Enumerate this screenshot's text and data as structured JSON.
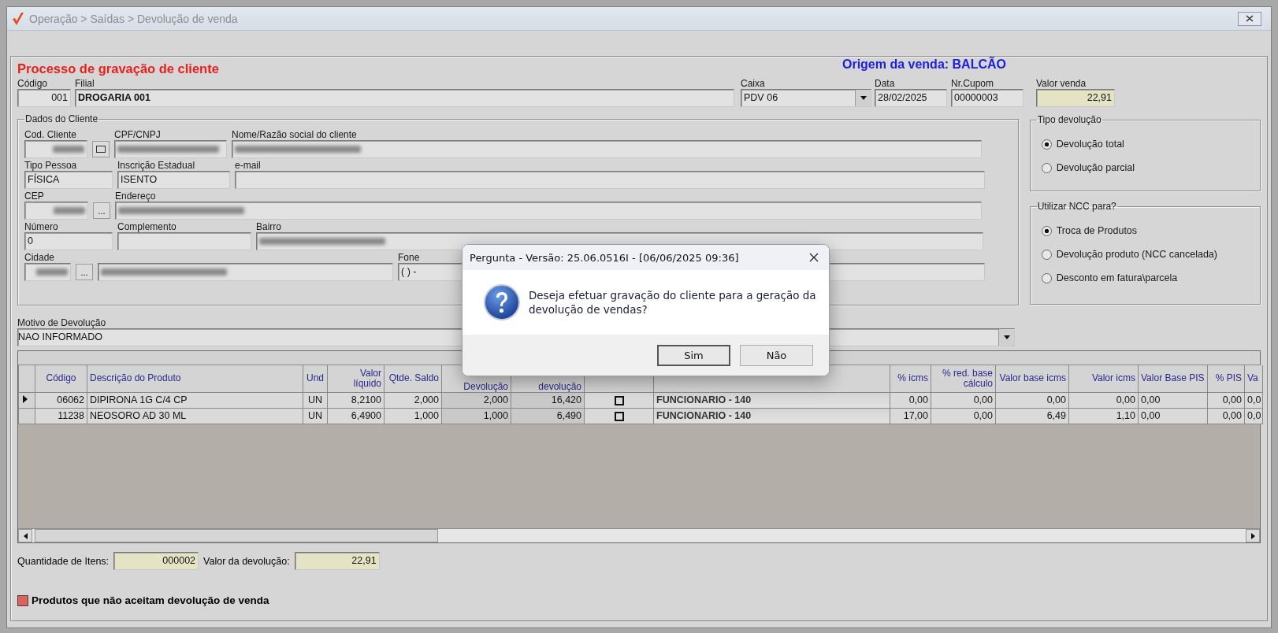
{
  "window": {
    "title": "Operação > Saídas > Devolução de venda"
  },
  "form": {
    "heading": "Processo de gravação de cliente",
    "origin": "Origem da venda: BALCÃO",
    "fields": [
      {
        "label": "Código",
        "value": "001",
        "kind": "text"
      },
      {
        "label": "Filial",
        "value": "DROGARIA 001",
        "kind": "text"
      },
      {
        "label": "Caixa",
        "value": "PDV 06",
        "kind": "combo"
      },
      {
        "label": "Data",
        "value": "28/02/2025",
        "kind": "text"
      },
      {
        "label": "Nr.Cupom",
        "value": "00000003",
        "kind": "text"
      },
      {
        "label": "Valor venda",
        "value": "22,91",
        "kind": "highlight"
      }
    ]
  },
  "client": {
    "title": "Dados do Cliente",
    "rows": [
      [
        {
          "label": "Cod. Cliente",
          "kind": "lookup",
          "redacted": true
        },
        {
          "label": "CPF/CNPJ",
          "kind": "text",
          "redacted": true
        },
        {
          "label": "Nome/Razão social do cliente",
          "kind": "text",
          "redacted": true
        }
      ],
      [
        {
          "label": "Tipo Pessoa",
          "value": "FÍSICA",
          "kind": "text",
          "redacted": false
        },
        {
          "label": "Inscrição Estadual",
          "value": "ISENTO",
          "kind": "text",
          "redacted": false
        },
        {
          "label": "e-mail",
          "kind": "text",
          "redacted": false
        }
      ],
      [
        {
          "label": "CEP",
          "kind": "browse",
          "button": "...",
          "redacted": true
        },
        {
          "label": "Endereço",
          "kind": "text",
          "redacted": true
        }
      ],
      [
        {
          "label": "Número",
          "value": "0",
          "kind": "text",
          "redacted": false
        },
        {
          "label": "Complemento",
          "kind": "text",
          "redacted": false
        },
        {
          "label": "Bairro",
          "kind": "text",
          "redacted": true
        }
      ],
      [
        {
          "label": "Cidade",
          "kind": "browse",
          "button": "...",
          "redacted": true
        },
        {
          "kind": "text",
          "redacted": true
        },
        {
          "label": "Fone",
          "value": "( )  -",
          "kind": "text",
          "redacted": false
        }
      ]
    ]
  },
  "tipo_devolucao": {
    "title": "Tipo devolução",
    "options": [
      {
        "label": "Devolução total",
        "selected": true
      },
      {
        "label": "Devolução parcial",
        "selected": false
      }
    ]
  },
  "utilizar_ncc": {
    "title": "Utilizar NCC para?",
    "options": [
      {
        "label": "Troca de Produtos",
        "selected": true
      },
      {
        "label": "Devolução produto (NCC cancelada)",
        "selected": false
      },
      {
        "label": "Desconto em fatura\\parcela",
        "selected": false
      }
    ]
  },
  "motivo": {
    "label": "Motivo de Devolução",
    "value": "NAO INFORMADO"
  },
  "grid": {
    "columns": [
      {
        "label": "Código",
        "kind": "code"
      },
      {
        "label": "Descrição do Produto",
        "kind": "text"
      },
      {
        "label": "Und",
        "kind": "center"
      },
      {
        "label": "Valor líquido",
        "kind": "number"
      },
      {
        "label": "Qtde. Saldo",
        "kind": "number"
      },
      {
        "label": "Devolução",
        "kind": "input"
      },
      {
        "label": "devolução",
        "kind": "input"
      },
      {
        "kind": "check"
      },
      {
        "kind": "text"
      },
      {
        "label": "% icms",
        "kind": "number"
      },
      {
        "label": "% red. base cálculo",
        "kind": "number"
      },
      {
        "label": "Valor base icms",
        "kind": "number"
      },
      {
        "label": "Valor icms",
        "kind": "number"
      },
      {
        "label": "Valor Base PIS",
        "kind": "text"
      },
      {
        "label": "% PIS",
        "kind": "number"
      },
      {
        "label": "Va",
        "kind": "text"
      }
    ],
    "rows": [
      {
        "selected": true,
        "checked": false,
        "cells": [
          "06062",
          "DIPIRONA  1G C/4 CP",
          "UN",
          "8,2100",
          "2,000",
          "2,000",
          "16,420",
          "",
          "FUNCIONARIO - 140",
          "0,00",
          "0,00",
          "0,00",
          "0,00",
          "0,00",
          "0,00",
          "0,0"
        ]
      },
      {
        "selected": false,
        "checked": false,
        "cells": [
          "11238",
          "NEOSORO AD 30 ML",
          "UN",
          "6,4900",
          "1,000",
          "1,000",
          "6,490",
          "",
          "FUNCIONARIO - 140",
          "17,00",
          "0,00",
          "6,49",
          "1,10",
          "0,00",
          "0,00",
          "0,0"
        ]
      }
    ]
  },
  "totals": [
    {
      "label": "Quantidade de Itens:",
      "value": "000002"
    },
    {
      "label": "Valor da devolução:",
      "value": "22,91"
    }
  ],
  "legend": {
    "text": "Produtos que não aceitam devolução de venda",
    "color": "#e06060"
  },
  "dialog": {
    "title": "Pergunta - Versão: 25.06.0516I - [06/06/2025 09:36]",
    "message": "Deseja efetuar gravação do cliente para a geração da devolução de vendas?",
    "buttons": [
      {
        "label": "Sim",
        "default": true
      },
      {
        "label": "Não",
        "default": false
      }
    ]
  }
}
